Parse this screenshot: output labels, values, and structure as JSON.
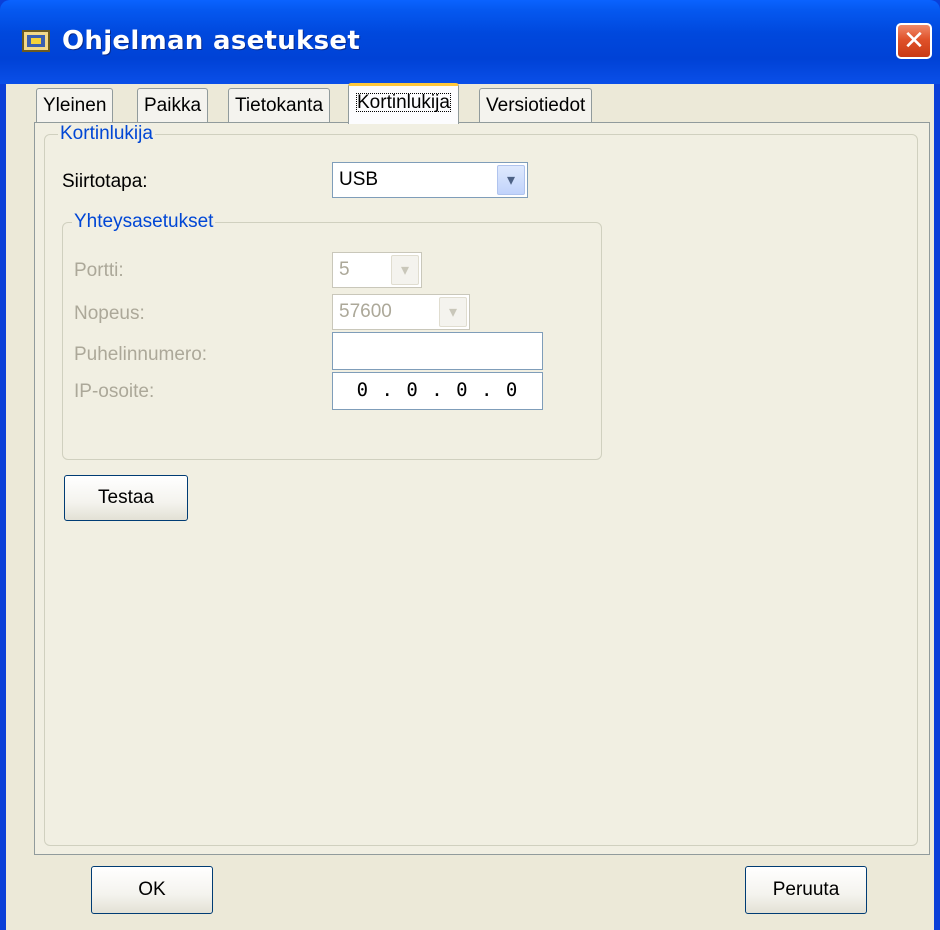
{
  "window": {
    "title": "Ohjelman asetukset",
    "close_glyph": "✕"
  },
  "tabs": [
    {
      "label": "Yleinen"
    },
    {
      "label": "Paikka"
    },
    {
      "label": "Tietokanta"
    },
    {
      "label": "Kortinlukija"
    },
    {
      "label": "Versiotiedot"
    }
  ],
  "active_tab": "Kortinlukija",
  "card_reader": {
    "group_title": "Kortinlukija",
    "transfer_label": "Siirtotapa:",
    "transfer_value": "USB",
    "connection": {
      "group_title": "Yhteysasetukset",
      "port_label": "Portti:",
      "port_value": "5",
      "speed_label": "Nopeus:",
      "speed_value": "57600",
      "phone_label": "Puhelinnumero:",
      "phone_value": "",
      "ip_label": "IP-osoite:",
      "ip_value": "0 . 0 . 0 . 0"
    },
    "test_button": "Testaa"
  },
  "footer": {
    "ok_button": "OK",
    "cancel_button": "Peruuta"
  },
  "colors": {
    "titlebar": "#0048dd",
    "group_title": "#0046d5",
    "dialog_bg": "#ece9d8",
    "active_tab_accent": "#ffc83c"
  },
  "icons": {
    "arrow": "▾",
    "app_icon": "app-icon"
  }
}
